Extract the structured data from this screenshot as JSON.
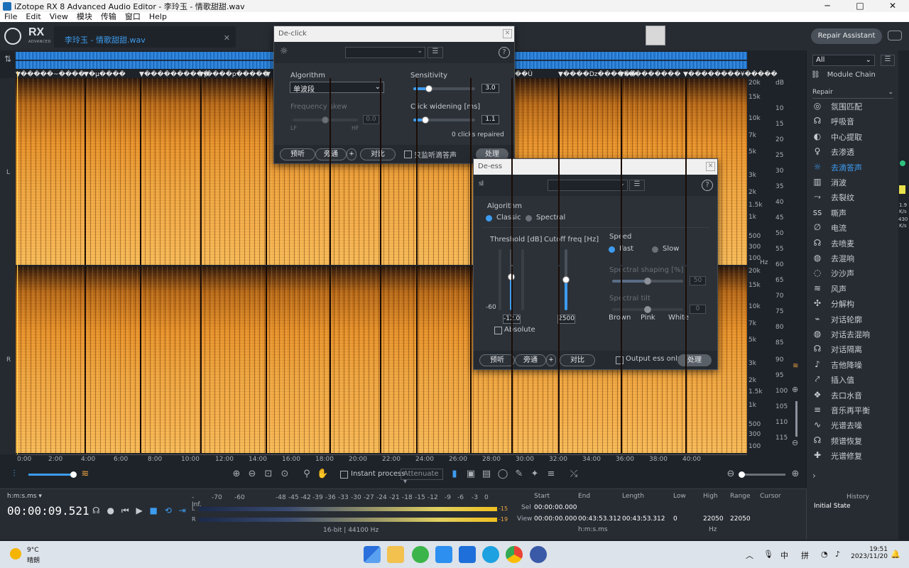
{
  "window": {
    "title": "iZotope RX 8 Advanced Audio Editor - 李玲玉 - 情歌甜甜.wav",
    "minimize": "─",
    "maximize": "□",
    "close": "✕"
  },
  "menu": [
    "File",
    "Edit",
    "View",
    "模块",
    "传输",
    "窗口",
    "Help"
  ],
  "header": {
    "logo": "RX",
    "logo_sub": "ADVANCED",
    "file_tab": "李玲玉 - 情歌甜甜.wav",
    "file_tab_close": "✕",
    "repair_assistant": "Repair Assistant"
  },
  "markers": [
    "▼�����~����",
    "▼�µ����",
    "▼����������",
    "▼|����p�����",
    "▼",
    "▼",
    "▼",
    "▼",
    "▼",
    "▼",
    "▼��Ù",
    "▼����Dz������",
    "▼h��������",
    "▼��������¥�����"
  ],
  "channels": {
    "left": "L",
    "right": "R"
  },
  "hz_top": [
    "20k",
    "15k",
    "10k",
    "7k",
    "5k",
    "3k",
    "2k",
    "1.5k",
    "1k",
    "500",
    "300",
    "100"
  ],
  "hz_bot": [
    "20k",
    "15k",
    "10k",
    "7k",
    "5k",
    "3k",
    "2k",
    "1.5k",
    "1k",
    "500",
    "300",
    "100"
  ],
  "hz_unit": "Hz",
  "db_scale": [
    "dB",
    "10",
    "15",
    "20",
    "25",
    "30",
    "35",
    "40",
    "45",
    "50",
    "55",
    "60",
    "65",
    "70",
    "75",
    "80",
    "85",
    "90",
    "95",
    "100",
    "105",
    "110",
    "115"
  ],
  "time_ticks": [
    "0:00",
    "2:00",
    "4:00",
    "6:00",
    "8:00",
    "10:00",
    "12:00",
    "14:00",
    "16:00",
    "18:00",
    "20:00",
    "22:00",
    "24:00",
    "26:00",
    "28:00",
    "30:00",
    "32:00",
    "34:00",
    "36:00",
    "38:00",
    "40:00"
  ],
  "toolbar": {
    "instant_process": "Instant process",
    "attenuate": "Attenuate"
  },
  "transport": {
    "time_format": "h:m:s.ms ▾",
    "timecode": "00:00:09.521"
  },
  "meters": {
    "scale": [
      "-Inf.",
      "-70",
      "-60",
      "-48",
      "-45",
      "-42",
      "-39",
      "-36",
      "-33",
      "-30",
      "-27",
      "-24",
      "-21",
      "-18",
      "-15",
      "-12",
      "-9",
      "-6",
      "-3",
      "0"
    ],
    "left_label": "L",
    "right_label": "R",
    "left_peak": "-15",
    "right_peak": "-19",
    "left_level_db": -12,
    "right_level_db": -10,
    "format": "16-bit | 44100 Hz"
  },
  "selection": {
    "start_h": "Start",
    "end_h": "End",
    "length_h": "Length",
    "low_h": "Low",
    "high_h": "High",
    "range_h": "Range",
    "cursor_h": "Cursor",
    "sel_label": "Sel",
    "view_label": "View",
    "sel_start": "00:00:00.000",
    "view_start": "00:00:00.000",
    "view_end": "00:43:53.312",
    "view_length": "00:43:53.312",
    "view_low": "0",
    "view_high": "22050",
    "view_range": "22050",
    "time_unit": "h:m:s.ms",
    "freq_unit": "Hz"
  },
  "history": {
    "title": "History",
    "item": "Initial State"
  },
  "rightpanel": {
    "filter": "All",
    "module_chain": "Module Chain",
    "category": "Repair",
    "modules": [
      {
        "label": "氛围匹配",
        "icon": "◎"
      },
      {
        "label": "呼吸音",
        "icon": "☊"
      },
      {
        "label": "中心提取",
        "icon": "◐"
      },
      {
        "label": "去渗透",
        "icon": "♀"
      },
      {
        "label": "去滴答声",
        "icon": "☼"
      },
      {
        "label": "消波",
        "icon": "▥"
      },
      {
        "label": "去裂纹",
        "icon": "⤳"
      },
      {
        "label": "嘶声",
        "icon": "ss"
      },
      {
        "label": "电流",
        "icon": "∅"
      },
      {
        "label": "去喷麦",
        "icon": "☊"
      },
      {
        "label": "去混响",
        "icon": "◍"
      },
      {
        "label": "沙沙声",
        "icon": "◌"
      },
      {
        "label": "风声",
        "icon": "≋"
      },
      {
        "label": "分解构",
        "icon": "✣"
      },
      {
        "label": "对话轮廓",
        "icon": "⌁"
      },
      {
        "label": "对话去混响",
        "icon": "◍"
      },
      {
        "label": "对话隔离",
        "icon": "☊"
      },
      {
        "label": "吉他降噪",
        "icon": "♪"
      },
      {
        "label": "插入值",
        "icon": "⤤"
      },
      {
        "label": "去口水音",
        "icon": "❖"
      },
      {
        "label": "音乐再平衡",
        "icon": "≡"
      },
      {
        "label": "光谱去噪",
        "icon": "∿"
      },
      {
        "label": "频谱恢复",
        "icon": "☊"
      },
      {
        "label": "光谱修复",
        "icon": "✚"
      }
    ],
    "active_index": 4,
    "expand": "›"
  },
  "farright": {
    "v1": "1.9",
    "u1": "K/s",
    "v2": "430",
    "u2": "K/s"
  },
  "declick": {
    "title": "De-click",
    "algorithm_label": "Algorithm",
    "algorithm_value": "单波段",
    "sensitivity_label": "Sensitivity",
    "sensitivity_value": "3.0",
    "sensitivity_level": 0.25,
    "freq_skew_label": "Frequency skew",
    "freq_skew_value": "0.0",
    "freq_skew_level": 0.5,
    "lf": "LF",
    "hf": "HF",
    "click_widening_label": "Click widening [ms]",
    "click_widening_value": "1.1",
    "click_widening_level": 0.2,
    "clicks_repaired": "0 clicks repaired",
    "preview": "预听",
    "bypass": "旁通",
    "plus": "+",
    "compare": "对比",
    "monitor_clicks": "只监听滴答声",
    "process": "处理"
  },
  "deess": {
    "title": "De-ess",
    "algorithm_label": "Algorithm",
    "classic": "Classic",
    "spectral": "Spectral",
    "threshold_label": "Threshold [dB]",
    "threshold_value": "-12.0",
    "threshold_min": "-60",
    "threshold_level": 0.55,
    "cutoff_label": "Cutoff freq [Hz]",
    "cutoff_value": "2500",
    "cutoff_level": 0.5,
    "absolute": "Absolute",
    "speed_label": "Speed",
    "fast": "Fast",
    "slow": "Slow",
    "spectral_shaping_label": "Spectral shaping [%]",
    "spectral_shaping_value": "50",
    "spectral_shaping_level": 0.5,
    "spectral_tilt_label": "Spectral tilt",
    "spectral_tilt_value": "0",
    "spectral_tilt_level": 0.5,
    "brown": "Brown",
    "pink": "Pink",
    "white": "White",
    "preview": "预听",
    "bypass": "旁通",
    "plus": "+",
    "compare": "对比",
    "output_ess": "Output ess only",
    "process": "处理"
  },
  "taskbar": {
    "temp": "9°C",
    "weather": "晴朗",
    "ime1": "中",
    "ime2": "拼",
    "time": "19:51",
    "date": "2023/11/20",
    "chevron": "︿"
  }
}
